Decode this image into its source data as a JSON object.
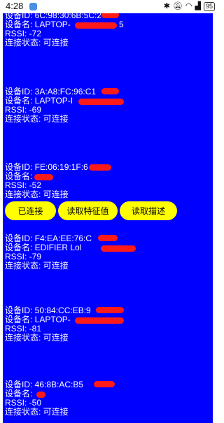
{
  "status_bar": {
    "time": "4:28",
    "icons": [
      "bluetooth-icon",
      "mute-icon",
      "wifi-icon",
      "signal-icon"
    ],
    "battery": "95"
  },
  "devices": [
    {
      "id": "设备ID: 6C:98:30:6B:5C:2",
      "name": "设备名: LAPTOP-",
      "name_suffix": "5",
      "rssi": "RSSI: -72",
      "status": "连接状态: 可连接"
    },
    {
      "id": "设备ID: 3A:A8:FC:96:C1",
      "name": "设备名: LAPTOP-I",
      "name_suffix": "",
      "rssi": "RSSI: -69",
      "status": "连接状态: 可连接"
    },
    {
      "id": "设备ID: FE:06:19:1F:6",
      "name": "设备名:",
      "name_suffix": "",
      "rssi": "RSSI: -52",
      "status": "连接状态: 可连接"
    },
    {
      "id": "设备ID: F4:EA:EE:76:C",
      "name": "设备名: EDIFIER Lol",
      "name_suffix": "",
      "rssi": "RSSI: -79",
      "status": "连接状态: 可连接"
    },
    {
      "id": "设备ID: 50:84:CC:EB:9",
      "name": "设备名: LAPTOP-",
      "name_suffix": "",
      "rssi": "RSSI: -81",
      "status": "连接状态: 可连接"
    },
    {
      "id": "设备ID: 46:8B:AC:B5",
      "name": "设备名:",
      "name_suffix": "",
      "rssi": "RSSI: -50",
      "status": "连接状态: 可连接"
    }
  ],
  "actions": {
    "connected_label": "已连接",
    "read_characteristic_label": "读取特征值",
    "read_descriptor_label": "读取描述"
  },
  "colors": {
    "background": "#0000ff",
    "text": "#ffffff",
    "button": "#ffff00",
    "redaction": "#ff1a1a"
  }
}
